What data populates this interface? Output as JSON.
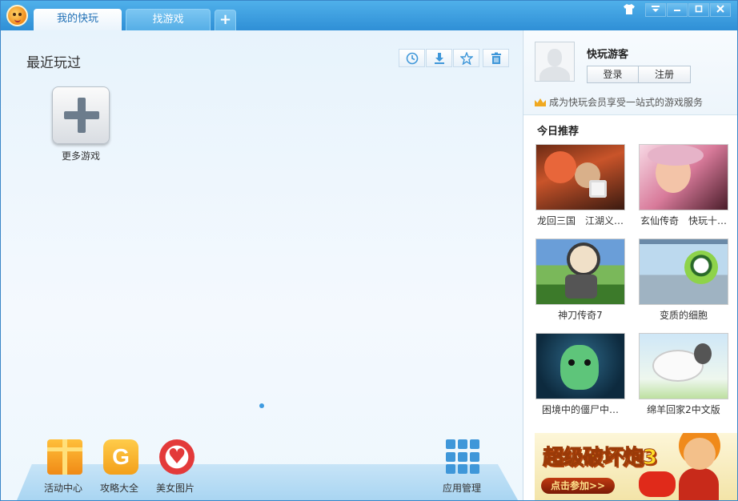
{
  "titlebar": {
    "tabs": [
      {
        "label": "我的快玩",
        "active": true
      },
      {
        "label": "找游戏",
        "active": false
      }
    ],
    "add_tab_symbol": "+",
    "window_buttons": [
      "skin-icon",
      "menu-icon",
      "minimize-icon",
      "maximize-icon",
      "close-icon"
    ]
  },
  "main": {
    "section_title": "最近玩过",
    "toolbar_icons": [
      "clock-icon",
      "download-icon",
      "star-icon",
      "trash-icon"
    ],
    "more_games_label": "更多游戏"
  },
  "dock": {
    "items": [
      {
        "label": "活动中心",
        "icon": "gift-icon"
      },
      {
        "label": "攻略大全",
        "icon": "guide-g-icon",
        "glyph": "G"
      },
      {
        "label": "美女图片",
        "icon": "heart-icon"
      },
      {
        "label": "应用管理",
        "icon": "app-grid-icon"
      }
    ]
  },
  "sidebar": {
    "username": "快玩游客",
    "login_label": "登录",
    "register_label": "注册",
    "vip_text": "成为快玩会员享受一站式的游戏服务",
    "recommend_title": "今日推荐",
    "games": [
      {
        "caption": "龙回三国　江湖义…"
      },
      {
        "caption": "玄仙传奇　快玩十…"
      },
      {
        "caption": "神刀传奇7"
      },
      {
        "caption": "变质的细胞"
      },
      {
        "caption": "困境中的僵尸中…"
      },
      {
        "caption": "绵羊回家2中文版"
      }
    ],
    "banner": {
      "title": "超级破坏炮3",
      "button": "点击参加>>"
    }
  },
  "colors": {
    "titlebar": "#2f8fd6",
    "accent": "#3f97d9",
    "dock": "#a9d5f2"
  }
}
